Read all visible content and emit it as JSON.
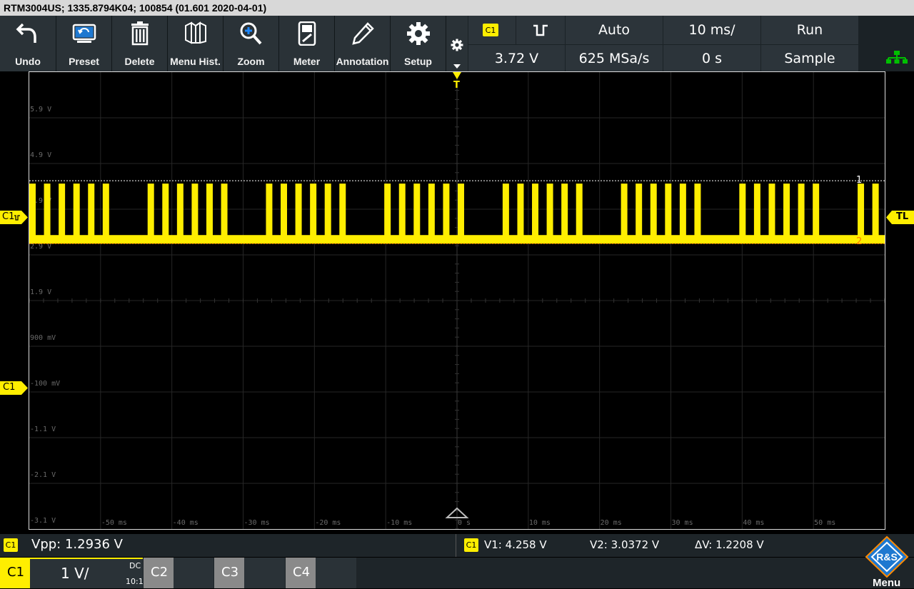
{
  "titlebar": {
    "text": "RTM3004US; 1335.8794K04; 100854 (01.601 2020-04-01)"
  },
  "toolbar": {
    "buttons": [
      {
        "label": "Undo",
        "icon": "undo-icon"
      },
      {
        "label": "Preset",
        "icon": "preset-icon"
      },
      {
        "label": "Delete",
        "icon": "trash-icon"
      },
      {
        "label": "Menu Hist.",
        "icon": "menu-history-icon"
      },
      {
        "label": "Zoom",
        "icon": "zoom-icon"
      },
      {
        "label": "Meter",
        "icon": "meter-icon"
      },
      {
        "label": "Annotation",
        "icon": "pen-icon"
      },
      {
        "label": "Setup",
        "icon": "gear-icon"
      }
    ]
  },
  "trigger_panel": {
    "channel": "C1",
    "slope_icon": "pulse-trigger-icon",
    "mode": "Auto",
    "timebase": "10 ms/",
    "run_state": "Run",
    "level": "3.72 V",
    "sample_rate": "625 MSa/s",
    "position": "0 s",
    "acq_mode": "Sample"
  },
  "screen": {
    "trigger_marker": "T",
    "trigger_level_tag": "TL",
    "channel_tag": "C1",
    "cursor_labels": [
      "1",
      "2"
    ],
    "y_labels": [
      "5.9 V",
      "4.9 V",
      "3.9 V",
      "2.9 V",
      "1.9 V",
      "900 mV",
      "-100 mV",
      "-1.1 V",
      "-2.1 V",
      "-3.1 V"
    ],
    "x_labels": [
      "-50 ms",
      "-40 ms",
      "-30 ms",
      "-20 ms",
      "-10 ms",
      "0 s",
      "10 ms",
      "20 ms",
      "30 ms",
      "40 ms",
      "50 ms"
    ]
  },
  "waveform": {
    "channel": "C1",
    "color": "#ffee00",
    "time_div_ms": 10,
    "volts_per_div": 1,
    "low_level_v": 3.04,
    "high_level_v": 4.26,
    "burst_period_ms": 16.6,
    "first_burst_start_ms": -60.0,
    "pulses_per_burst": 6,
    "pulse_period_ms": 2.06,
    "pulse_width_ms": 0.9
  },
  "measurements": {
    "channel": "C1",
    "vpp": "Vpp: 1.2936 V",
    "v1": "V1: 4.258 V",
    "v2": "V2: 3.0372 V",
    "dv": "ΔV: 1.2208 V"
  },
  "channels": {
    "c1": {
      "name": "C1",
      "scale": "1 V/",
      "coupling": "DC",
      "probe": "10:1"
    },
    "c2": {
      "name": "C2"
    },
    "c3": {
      "name": "C3"
    },
    "c4": {
      "name": "C4"
    }
  },
  "menu": {
    "label": "Menu",
    "logo": "R&S"
  },
  "colors": {
    "accent": "#ffee00",
    "cursor2": "#ff7a00",
    "network": "#00c000",
    "logo": "#1e78d0"
  }
}
